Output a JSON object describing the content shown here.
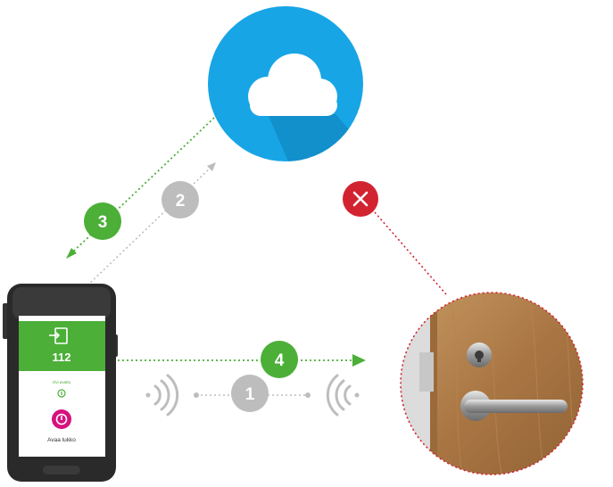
{
  "colors": {
    "cloud_blue": "#17a5e6",
    "green": "#4caf38",
    "gray": "#bdbdbd",
    "red": "#d22430",
    "magenta": "#d6117e"
  },
  "steps": [
    {
      "label": "1",
      "state": "inactive"
    },
    {
      "label": "2",
      "state": "inactive"
    },
    {
      "label": "3",
      "state": "active"
    },
    {
      "label": "4",
      "state": "active"
    }
  ],
  "failure_icon": "close-icon",
  "phone": {
    "door_number": "112",
    "status_text": "Ovi avattu",
    "action_label": "Avaa lukko"
  }
}
